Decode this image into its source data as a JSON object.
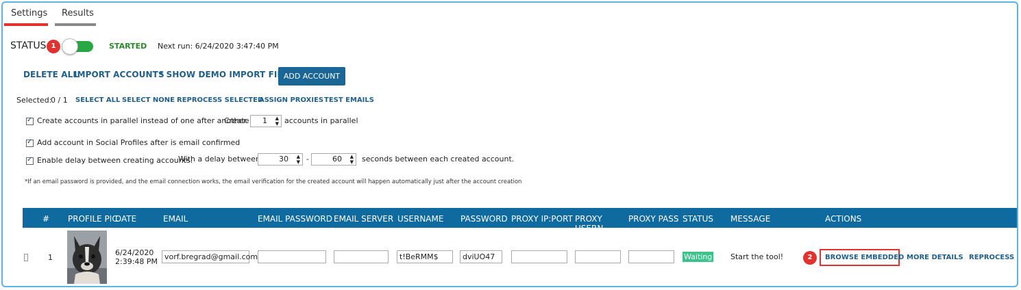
{
  "tabs": [
    {
      "label": "Settings",
      "active": true
    },
    {
      "label": "Results",
      "active": false
    }
  ],
  "status": {
    "label": "STATUS",
    "state_text": "STARTED",
    "next_run": "Next run: 6/24/2020 3:47:40 PM",
    "toggle_on": true
  },
  "callouts": {
    "one": "1",
    "two": "2"
  },
  "actions": {
    "delete_all": "DELETE ALL",
    "import_accounts": "IMPORT ACCOUNTS",
    "show_demo": "* SHOW DEMO IMPORT FILE",
    "add_account": "ADD ACCOUNT"
  },
  "selection": {
    "label": "Selected:",
    "count": "0 / 1",
    "select_all": "SELECT ALL",
    "select_none": "SELECT NONE",
    "reprocess_selected": "REPROCESS SELECTED",
    "assign_proxies": "ASSIGN PROXIES",
    "test_emails": "TEST EMAILS"
  },
  "options": {
    "parallel_label": "Create accounts in parallel instead of one after another.",
    "parallel_create": "Create",
    "parallel_value": "1",
    "parallel_suffix": "accounts in parallel",
    "social_label": "Add account in Social Profiles after is email confirmed",
    "delay_label": "Enable delay between creating accounts.",
    "delay_prefix": "With a delay between",
    "delay_min": "30",
    "delay_dash": "-",
    "delay_max": "60",
    "delay_suffix": "seconds between each created account."
  },
  "note": "*If an email password is provided, and the email connection works, the email verification for the created account will happen automatically just after the account creation",
  "table": {
    "headers": [
      "#",
      "PROFILE PIC",
      "DATE",
      "EMAIL",
      "EMAIL PASSWORD",
      "EMAIL SERVER",
      "USERNAME",
      "PASSWORD",
      "PROXY IP:PORT",
      "PROXY USERN",
      "PROXY PASS",
      "STATUS",
      "MESSAGE",
      "ACTIONS"
    ],
    "row": {
      "index": "1",
      "date_line1": "6/24/2020",
      "date_line2": "2:39:48 PM",
      "email": "vorf.bregrad@gmail.com",
      "email_password": "",
      "email_server": "",
      "username": "t!BeRMM$",
      "password": "dviUO47",
      "proxy_ip": "",
      "proxy_user": "",
      "proxy_pass": "",
      "status": "Waiting",
      "message": "Start the tool!",
      "browse_embedded": "BROWSE EMBEDDED",
      "more_details": "MORE DETAILS",
      "reprocess": "REPROCESS"
    }
  },
  "colors": {
    "accent": "#1a6696",
    "header_bg": "#0f6aa0",
    "started": "#2a8a2a",
    "toggle": "#28a745",
    "waiting_bg": "#3cc28a",
    "callout": "#e0322e",
    "tab_active": "#e0322e",
    "tab_inactive": "#888888",
    "frame": "#5bb3e6"
  }
}
